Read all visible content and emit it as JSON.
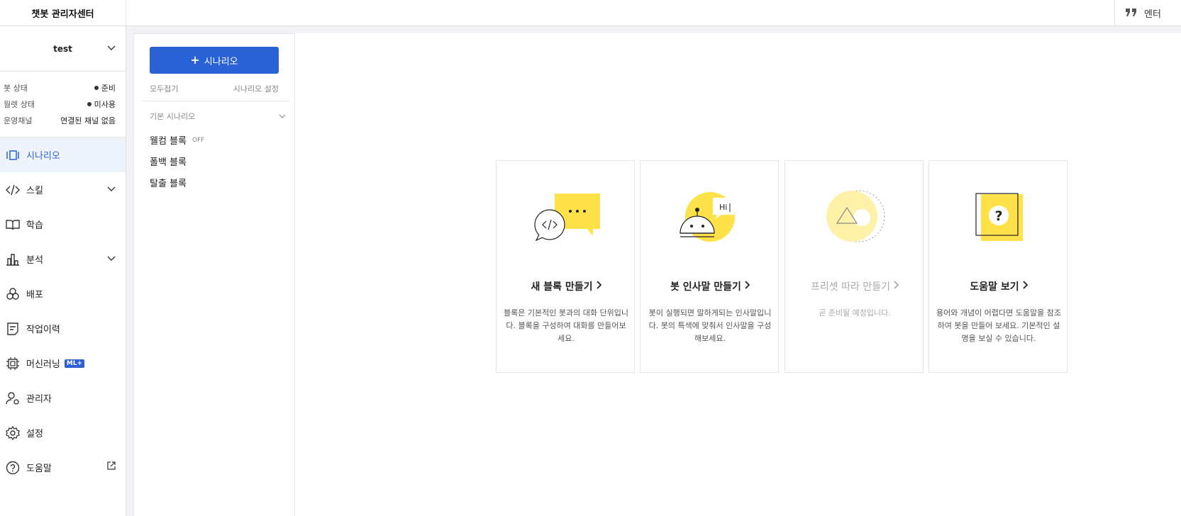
{
  "app": {
    "title": "챗봇 관리자센터"
  },
  "header": {
    "right_text": "엔터"
  },
  "bot": {
    "name": "test",
    "status": [
      {
        "label": "봇 상태",
        "value": "준비",
        "dot": true
      },
      {
        "label": "월렛 상태",
        "value": "미사용",
        "dot": true
      },
      {
        "label": "운영채널",
        "value": "연결된 채널 없음",
        "dot": false
      }
    ]
  },
  "nav": {
    "scenario": "시나리오",
    "skill": "스킬",
    "learning": "학습",
    "analysis": "분석",
    "deploy": "배포",
    "history": "작업이력",
    "ml": "머신러닝",
    "ml_badge": "ML+",
    "admin": "관리자",
    "settings": "설정",
    "help": "도움말"
  },
  "scenario_panel": {
    "add_label": "시나리오",
    "collapse_all": "모두접기",
    "settings": "시나리오 설정",
    "group": "기본 시나리오",
    "blocks": [
      {
        "label": "웰컴 블록",
        "tag": "OFF"
      },
      {
        "label": "폴백 블록",
        "tag": ""
      },
      {
        "label": "탈출 블록",
        "tag": ""
      }
    ]
  },
  "cards": [
    {
      "title": "새 블록 만들기",
      "desc": "블록은 기본적인 봇과의 대화 단위입니다. 블록을 구성하여 대화를 만들어보세요."
    },
    {
      "title": "봇 인사말 만들기",
      "desc": "봇이 실행되면 말하게되는 인사말입니다. 봇의 특색에 맞춰서 인사말을 구성해보세요.",
      "bubble": "Hi"
    },
    {
      "title": "프리셋 따라 만들기",
      "desc": "곧 준비될 예정입니다."
    },
    {
      "title": "도움말 보기",
      "desc": "용어와 개념이 어렵다면 도움말을 참조하여 봇을 만들어 보세요. 기본적인 설명을 보실 수 있습니다."
    }
  ],
  "colors": {
    "accent": "#2a62d6",
    "yellow": "#ffe14a",
    "yellow_light": "#fff2a8"
  }
}
